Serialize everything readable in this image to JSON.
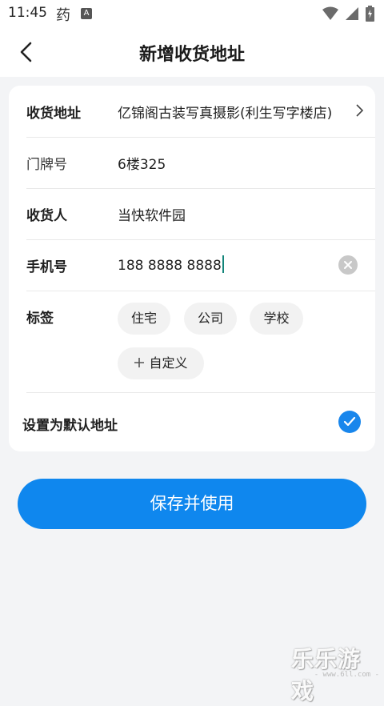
{
  "status_bar": {
    "time": "11:45",
    "app_glyph": "药",
    "a_badge": "A",
    "icons": [
      "wifi-icon",
      "signal-icon",
      "battery-icon"
    ]
  },
  "nav": {
    "title": "新增收货地址",
    "back_icon": "chevron-left-icon"
  },
  "form": {
    "address": {
      "label": "收货地址",
      "value": "亿锦阁古装写真摄影(利生写字楼店)"
    },
    "door": {
      "label": "门牌号",
      "value": "6楼325"
    },
    "receiver": {
      "label": "收货人",
      "value": "当快软件园"
    },
    "phone": {
      "label": "手机号",
      "value": "188 8888 8888"
    },
    "tags": {
      "label": "标签",
      "options": [
        "住宅",
        "公司",
        "学校"
      ],
      "custom": "自定义",
      "custom_icon": "plus-icon"
    },
    "default": {
      "label": "设置为默认地址",
      "checked": true
    }
  },
  "actions": {
    "save": "保存并使用"
  },
  "watermark": {
    "text": "乐乐游戏",
    "url": "- www.6ll.com -"
  },
  "colors": {
    "accent": "#0f87ee",
    "check": "#1886ec",
    "caret": "#13857a"
  }
}
